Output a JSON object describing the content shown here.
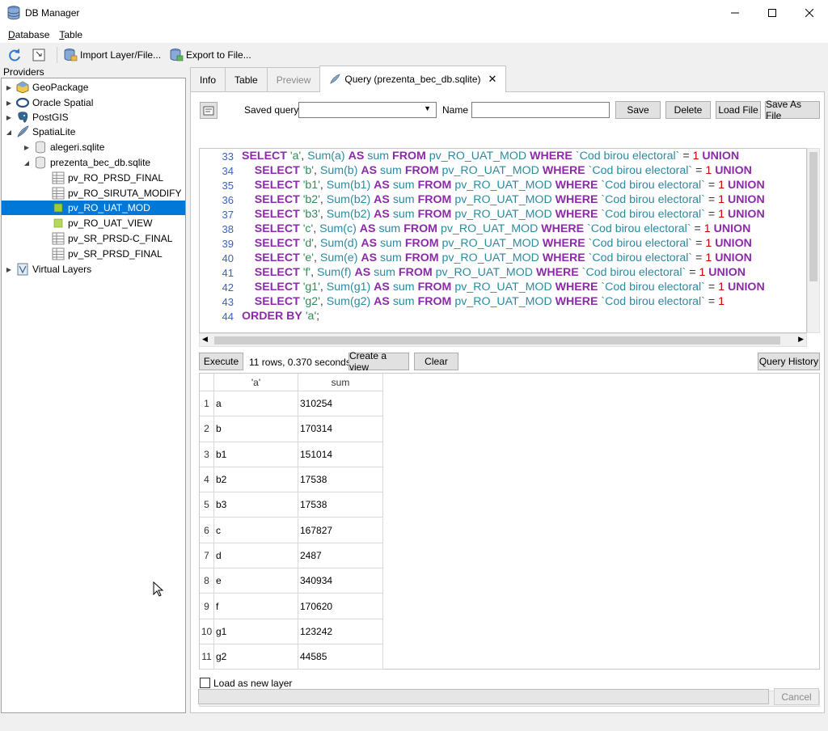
{
  "window": {
    "title": "DB Manager",
    "controls": [
      "minimize",
      "maximize",
      "close"
    ]
  },
  "menu": [
    {
      "label": "Database",
      "underline": "D",
      "rest": "atabase"
    },
    {
      "label": "Table",
      "underline": "T",
      "rest": "able"
    }
  ],
  "toolbar": {
    "refresh_icon": "refresh-icon",
    "import_label": "Import Layer/File...",
    "export_label": "Export to File..."
  },
  "providers": {
    "label": "Providers",
    "items": [
      {
        "label": "GeoPackage",
        "icon": "geopackage-icon",
        "level": 0,
        "expanded": false
      },
      {
        "label": "Oracle Spatial",
        "icon": "oracle-icon",
        "level": 0,
        "expanded": false
      },
      {
        "label": "PostGIS",
        "icon": "postgis-icon",
        "level": 0,
        "expanded": false
      },
      {
        "label": "SpatiaLite",
        "icon": "spatialite-icon",
        "level": 0,
        "expanded": true
      },
      {
        "label": "alegeri.sqlite",
        "icon": "database-icon",
        "level": 1,
        "expanded": false
      },
      {
        "label": "prezenta_bec_db.sqlite",
        "icon": "database-icon",
        "level": 1,
        "expanded": true
      },
      {
        "label": "pv_RO_PRSD_FINAL",
        "icon": "table-icon",
        "level": 2
      },
      {
        "label": "pv_RO_SIRUTA_MODIFY",
        "icon": "table-icon",
        "level": 2
      },
      {
        "label": "pv_RO_UAT_MOD",
        "icon": "layer-icon",
        "level": 2,
        "selected": true
      },
      {
        "label": "pv_RO_UAT_VIEW",
        "icon": "layer-icon",
        "level": 2
      },
      {
        "label": "pv_SR_PRSD-C_FINAL",
        "icon": "table-icon",
        "level": 2
      },
      {
        "label": "pv_SR_PRSD_FINAL",
        "icon": "table-icon",
        "level": 2
      },
      {
        "label": "Virtual Layers",
        "icon": "virtual-layers-icon",
        "level": 0,
        "expanded": false
      }
    ]
  },
  "tabs": [
    {
      "label": "Info",
      "state": "normal"
    },
    {
      "label": "Table",
      "state": "normal"
    },
    {
      "label": "Preview",
      "state": "disabled"
    },
    {
      "label": "Query (prezenta_bec_db.sqlite)",
      "state": "active"
    }
  ],
  "query_bar": {
    "saved_query_label": "Saved query",
    "saved_query_value": "",
    "name_label": "Name",
    "name_value": "",
    "save": "Save",
    "delete": "Delete",
    "load_file": "Load File",
    "save_as_file": "Save As File"
  },
  "editor": {
    "lines": [
      {
        "n": "33",
        "indent": "",
        "t": "'a'",
        "a": "a",
        "last": false
      },
      {
        "n": "34",
        "indent": "    ",
        "t": "'b'",
        "a": "b",
        "last": false
      },
      {
        "n": "35",
        "indent": "    ",
        "t": "'b1'",
        "a": "b1",
        "last": false
      },
      {
        "n": "36",
        "indent": "    ",
        "t": "'b2'",
        "a": "b2",
        "last": false
      },
      {
        "n": "37",
        "indent": "    ",
        "t": "'b3'",
        "a": "b2",
        "last": false
      },
      {
        "n": "38",
        "indent": "    ",
        "t": "'c'",
        "a": "c",
        "last": false
      },
      {
        "n": "39",
        "indent": "    ",
        "t": "'d'",
        "a": "d",
        "last": false
      },
      {
        "n": "40",
        "indent": "    ",
        "t": "'e'",
        "a": "e",
        "last": false
      },
      {
        "n": "41",
        "indent": "    ",
        "t": "'f'",
        "a": "f",
        "last": false
      },
      {
        "n": "42",
        "indent": "    ",
        "t": "'g1'",
        "a": "g1",
        "last": false
      },
      {
        "n": "43",
        "indent": "    ",
        "t": "'g2'",
        "a": "g2",
        "last": true
      }
    ],
    "final_line_number": "44",
    "final_line": "ORDER BY 'a';",
    "kw_select": "SELECT",
    "kw_as": "AS",
    "kw_sum_alias": "sum",
    "kw_from": "FROM",
    "kw_where": "WHERE",
    "kw_union": "UNION",
    "table_name": "pv_RO_UAT_MOD",
    "column_name": "`Cod birou electoral`",
    "compare": "= ",
    "value": "1",
    "func": "Sum"
  },
  "exec_bar": {
    "execute": "Execute",
    "status": "11 rows, 0.370 seconds",
    "create_view": "Create a view",
    "clear": "Clear",
    "query_history": "Query History"
  },
  "results": {
    "columns": [
      "'a'",
      "sum"
    ],
    "rows": [
      [
        "1",
        "a",
        "310254"
      ],
      [
        "2",
        "b",
        "170314"
      ],
      [
        "3",
        "b1",
        "151014"
      ],
      [
        "4",
        "b2",
        "17538"
      ],
      [
        "5",
        "b3",
        "17538"
      ],
      [
        "6",
        "c",
        "167827"
      ],
      [
        "7",
        "d",
        "2487"
      ],
      [
        "8",
        "e",
        "340934"
      ],
      [
        "9",
        "f",
        "170620"
      ],
      [
        "10",
        "g1",
        "123242"
      ],
      [
        "11",
        "g2",
        "44585"
      ]
    ]
  },
  "footer": {
    "load_as_layer": "Load as new layer",
    "cancel": "Cancel"
  }
}
